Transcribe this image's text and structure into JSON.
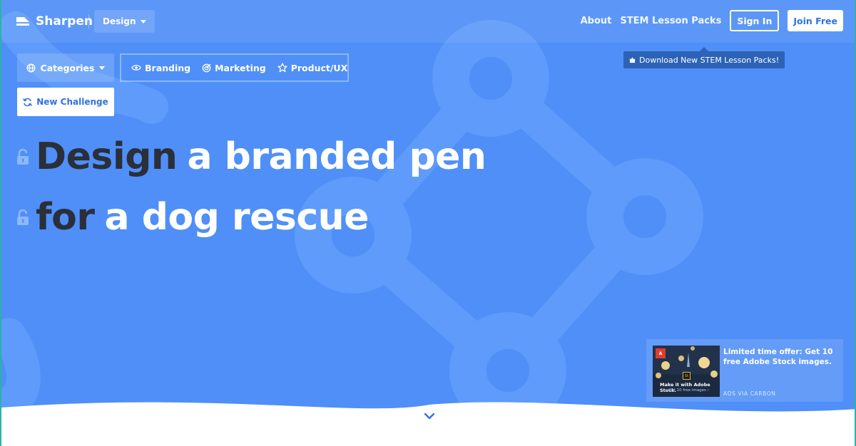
{
  "brand": {
    "name": "Sharpen",
    "mode": "Design"
  },
  "nav": {
    "about": "About",
    "stem": "STEM Lesson Packs",
    "sign_in": "Sign In",
    "join": "Join Free"
  },
  "promo": {
    "text": "Download New STEM Lesson Packs!"
  },
  "controls": {
    "categories": "Categories",
    "filters": [
      {
        "label": "Branding",
        "icon": "eye-icon"
      },
      {
        "label": "Marketing",
        "icon": "target-icon"
      },
      {
        "label": "Product/UX",
        "icon": "star-icon"
      }
    ],
    "new_challenge": "New Challenge"
  },
  "headline": {
    "line1_locked": "Design",
    "line1_rest": "a branded pen",
    "line2_locked": "for",
    "line2_rest": "a dog rescue"
  },
  "ad": {
    "text": "Limited time offer: Get 10 free Adobe Stock images.",
    "via": "ADS VIA CARBON",
    "image_caption": "Make it with Adobe Stock.",
    "image_sub": "Get 10 free images ›",
    "image_logo": "A",
    "image_badge": "St"
  },
  "colors": {
    "background": "#4f8ff7",
    "accent": "#2d72e6",
    "headline_dark": "#2b2f3a"
  }
}
